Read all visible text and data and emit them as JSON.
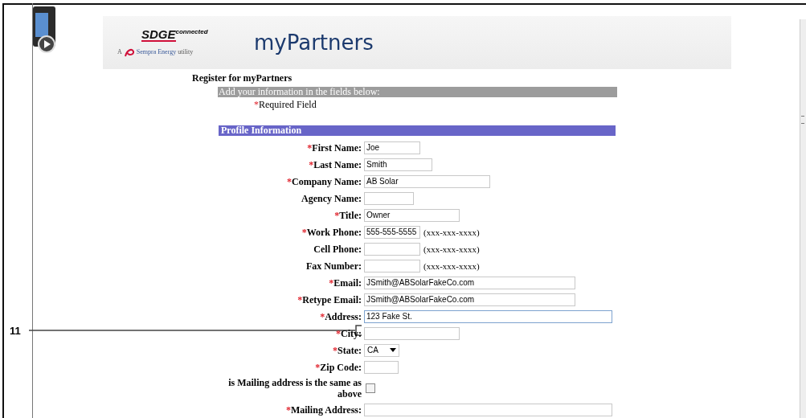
{
  "callout": {
    "number": "11"
  },
  "banner": {
    "logo_main": "SDGE",
    "logo_tag": "connected",
    "logo_sub": "A",
    "logo_sub2": "Sempra Energy",
    "logo_sub3": "utility",
    "title": "myPartners"
  },
  "page_title": "Register for myPartners",
  "instructions": "Add your information in the fields below:",
  "required_note": {
    "mark": "*",
    "text": "Required Field"
  },
  "section": {
    "title": "Profile Information"
  },
  "fields": [
    {
      "kind": "text",
      "label": "First Name:",
      "required": true,
      "value": "Joe"
    },
    {
      "kind": "text",
      "label": "Last Name:",
      "required": true,
      "value": "Smith"
    },
    {
      "kind": "text",
      "label": "Company Name:",
      "required": true,
      "value": "AB Solar"
    },
    {
      "kind": "text",
      "label": "Agency Name:",
      "required": false
    },
    {
      "kind": "text",
      "label": "Title:",
      "required": true,
      "value": "Owner"
    },
    {
      "kind": "text",
      "label": "Work Phone:",
      "required": true,
      "value": "555-555-5555",
      "hint": "(xxx-xxx-xxxx)"
    },
    {
      "kind": "text",
      "label": "Cell Phone:",
      "required": false,
      "hint": "(xxx-xxx-xxxx)"
    },
    {
      "kind": "text",
      "label": "Fax Number:",
      "required": false,
      "hint": "(xxx-xxx-xxxx)"
    },
    {
      "kind": "text",
      "label": "Email:",
      "required": true,
      "value": "JSmith@ABSolarFakeCo.com"
    },
    {
      "kind": "text",
      "label": "Retype Email:",
      "required": true,
      "value": "JSmith@ABSolarFakeCo.com"
    },
    {
      "kind": "text",
      "label": "Address:",
      "required": true,
      "value": "123 Fake St.",
      "focused": true
    },
    {
      "kind": "text",
      "label": "City:",
      "required": true
    },
    {
      "kind": "select",
      "label": "State:",
      "required": true,
      "value": "CA"
    },
    {
      "kind": "text",
      "label": "Zip Code:",
      "required": true
    },
    {
      "kind": "checkbox",
      "label": "is Mailing address is the same as above",
      "required": false,
      "checked": false
    },
    {
      "kind": "text",
      "label": "Mailing Address:",
      "required": true
    }
  ]
}
